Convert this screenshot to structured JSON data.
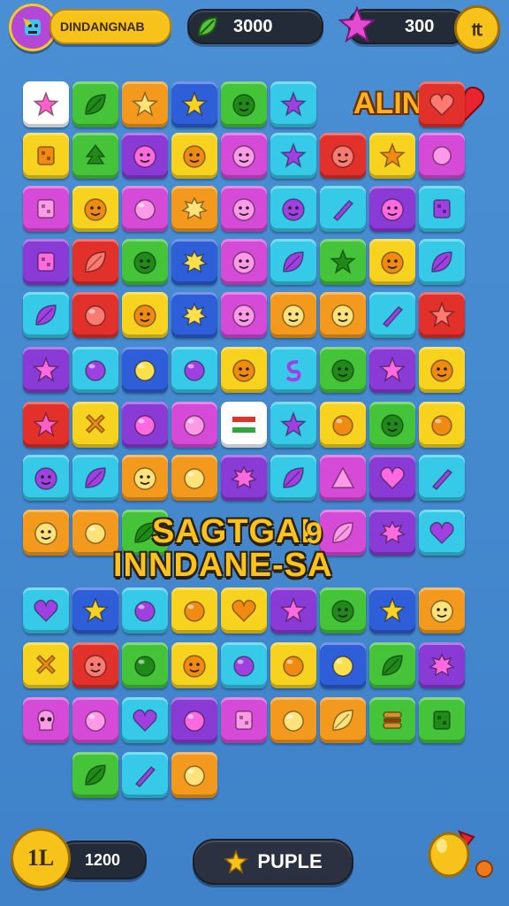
{
  "hud": {
    "player_name": "DINDANGNAB",
    "gems": "3000",
    "stars": "300",
    "level_button_glyph": "₶"
  },
  "top_labels": {
    "alin": "ALIN"
  },
  "banner": {
    "line1": "SAGTGAI",
    "line2": "INNDANE-SA",
    "extra_glyph": "9"
  },
  "footer": {
    "coin_glyph": "1L",
    "coins": "1200",
    "puzzle_button": "PUPLE"
  },
  "colors": {
    "background": "#4a8fd4",
    "accent_gold": "#f7c21a",
    "hud_dark": "#232a38"
  },
  "icons": [
    "avatar-icon",
    "leaf-gem-icon",
    "star-icon",
    "coin-icon",
    "heart-icon",
    "sparkle-icon",
    "balloon-icon"
  ],
  "board_rows": [
    [
      "sparkle-white",
      "leaf-green",
      "star-orange",
      "star-blue",
      "frog-green",
      "star-cyan",
      "blank",
      "blank",
      "heart-red"
    ],
    [
      "book-yellow",
      "tree-green",
      "face-purple",
      "face-yellow",
      "pig-magenta",
      "star-cyan",
      "pig-red",
      "star-yellow",
      "bow-magenta"
    ],
    [
      "dice-magenta",
      "face-yellow",
      "ball-magenta",
      "splat-orange",
      "pig-magenta",
      "frog-cyan",
      "brush-cyan",
      "face-purple",
      "pot-cyan"
    ],
    [
      "box-purple",
      "leaf-red",
      "face-green",
      "splat-blue",
      "pig-magenta",
      "leaf-cyan",
      "star-green",
      "face-yellow",
      "leaf-cyan"
    ],
    [
      "leaf-cyan",
      "ball-red",
      "face-yellow",
      "splat-blue",
      "pig-magenta",
      "face-orange",
      "face-orange",
      "brush-cyan",
      "star-red"
    ],
    [
      "star-purple",
      "ball-cyan",
      "fruit-blue",
      "ball-cyan",
      "frog-yellow",
      "snake-cyan",
      "face-green",
      "star-purple",
      "face-yellow"
    ],
    [
      "sparkle-red",
      "cross-yellow",
      "ball-purple",
      "ball-magenta",
      "flag-white",
      "star-cyan",
      "fruit-yellow",
      "face-green",
      "fruit-yellow"
    ],
    [
      "face-cyan",
      "leaf-cyan",
      "cat-orange",
      "ball-orange",
      "splat-purple",
      "leaf-cyan",
      "tri-magenta",
      "heart-purple",
      "sword-cyan"
    ],
    [
      "cat-orange",
      "ball-orange",
      "leaf-green",
      "blank",
      "blank",
      "blank",
      "leaf-magenta",
      "splat-purple",
      "heart-cyan"
    ],
    [
      "heart-cyan",
      "star-blue",
      "ball-cyan",
      "ball-yellow",
      "heart-yellow",
      "star-purple",
      "face-green",
      "star-blue",
      "pig-orange"
    ],
    [
      "cross-yellow",
      "face-red",
      "ball-green",
      "face-yellow",
      "fruit-cyan",
      "ball-yellow",
      "fruit-blue",
      "leaf-green",
      "flower-purple"
    ],
    [
      "skull-magenta",
      "ball-magenta",
      "heart-cyan",
      "ball-purple",
      "robot-magenta",
      "ball-orange",
      "leaf-orange",
      "burger-green",
      "dice-green"
    ],
    [
      "blank",
      "leaf-green",
      "brush-cyan",
      "ball-orange"
    ]
  ]
}
